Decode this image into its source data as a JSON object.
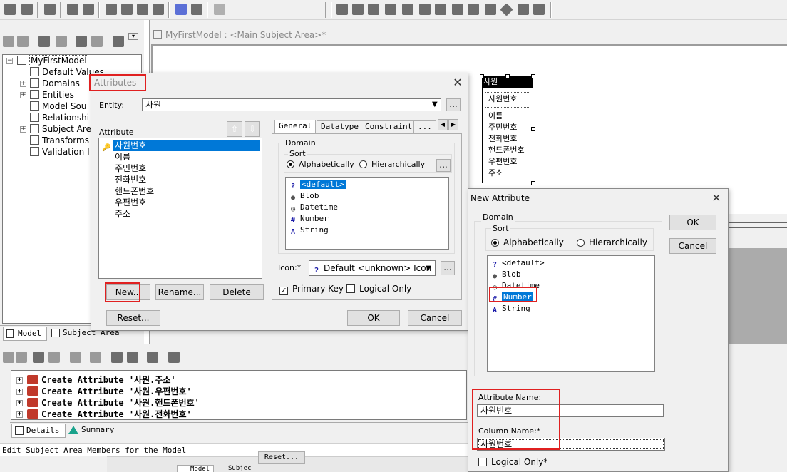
{
  "diagram": {
    "title": "MyFirstModel : <Main Subject Area>*",
    "entity": {
      "name": "사원",
      "pk": "사원번호",
      "attrs": [
        "이름",
        "주민번호",
        "전화번호",
        "핸드폰번호",
        "우편번호",
        "주소"
      ]
    }
  },
  "tree": {
    "root": "MyFirstModel",
    "items": [
      "Default Values",
      "Domains",
      "Entities",
      "Model Sou",
      "Relationshi",
      "Subject Are",
      "Transforms",
      "Validation I"
    ]
  },
  "left_tabs": {
    "model": "Model",
    "subject": "Subject Area"
  },
  "log": {
    "lines": [
      "Create Attribute '사원.주소'",
      "Create Attribute '사원.우편번호'",
      "Create Attribute '사원.핸드폰번호'",
      "Create Attribute '사원.전화번호'"
    ]
  },
  "bottom_tabs": {
    "details": "Details",
    "summary": "Summary"
  },
  "status": "Edit Subject Area Members for the Model",
  "bg_buttons": {
    "reset": "Reset...",
    "model": "Model",
    "subject": "Subjec"
  },
  "attributes_dialog": {
    "title": "Attributes",
    "entity_label": "Entity:",
    "entity_value": "사원",
    "attribute_label": "Attribute",
    "attributes": [
      "사원번호",
      "이름",
      "주민번호",
      "전화번호",
      "핸드폰번호",
      "우편번호",
      "주소"
    ],
    "buttons": {
      "new": "New...",
      "rename": "Rename...",
      "delete": "Delete",
      "reset": "Reset...",
      "ok": "OK",
      "cancel": "Cancel"
    },
    "tabs": [
      "General",
      "Datatype",
      "Constraint",
      "..."
    ],
    "domain_label": "Domain",
    "sort_label": "Sort",
    "sort_alpha": "Alphabetically",
    "sort_hier": "Hierarchically",
    "domains": [
      "<default>",
      "Blob",
      "Datetime",
      "Number",
      "String"
    ],
    "icon_label": "Icon:*",
    "icon_value": "Default <unknown> Icon",
    "primary_key": "Primary Key",
    "logical_only": "Logical Only",
    "ellipsis": "..."
  },
  "new_attribute_dialog": {
    "title": "New Attribute",
    "ok": "OK",
    "cancel": "Cancel",
    "domain_label": "Domain",
    "sort_label": "Sort",
    "sort_alpha": "Alphabetically",
    "sort_hier": "Hierarchically",
    "domains": [
      "<default>",
      "Blob",
      "Datetime",
      "Number",
      "String"
    ],
    "attr_name_label": "Attribute Name:",
    "attr_name_value": "사원번호",
    "col_name_label": "Column Name:*",
    "col_name_value": "사원번호",
    "logical_only": "Logical Only*"
  }
}
